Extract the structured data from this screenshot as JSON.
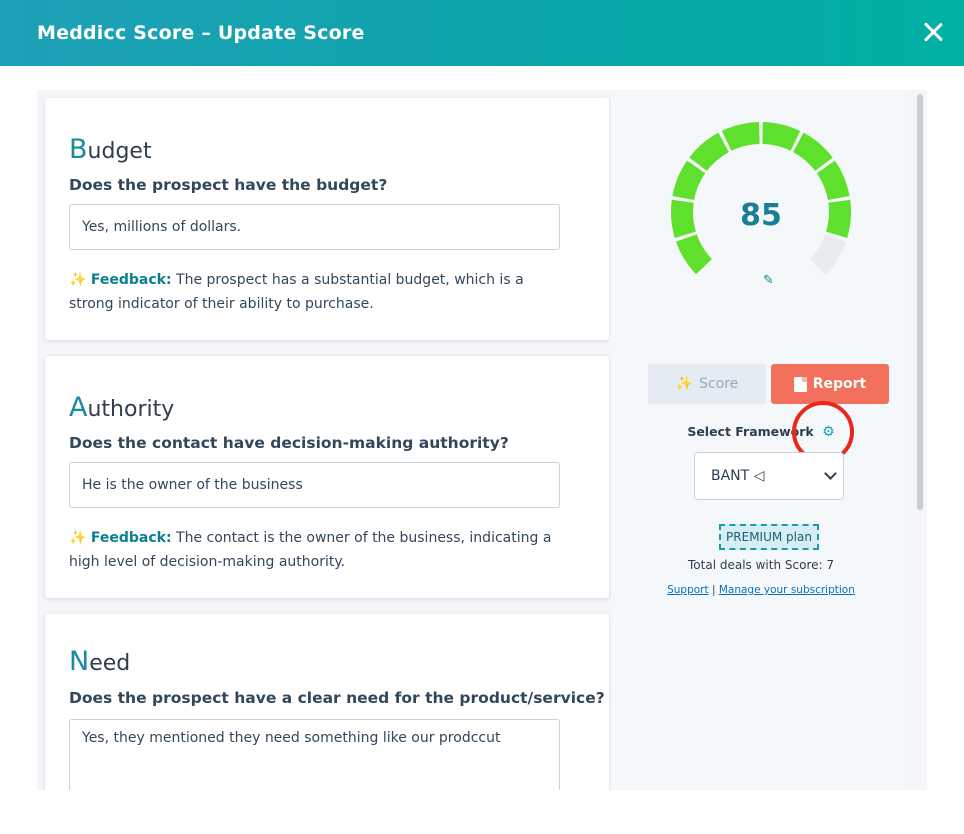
{
  "header": {
    "title": "Meddicc Score – Update Score"
  },
  "cards": [
    {
      "title_initial": "B",
      "title_rest": "udget",
      "question": "Does the prospect have the budget?",
      "answer": "Yes, millions of dollars.",
      "feedback_label": "Feedback:",
      "feedback_text": "The prospect has a substantial budget, which is a strong indicator of their ability to purchase."
    },
    {
      "title_initial": "A",
      "title_rest": "uthority",
      "question": "Does the contact have decision-making authority?",
      "answer": "He is the owner of the business",
      "feedback_label": "Feedback:",
      "feedback_text": "The contact is the owner of the business, indicating a high level of decision-making authority."
    },
    {
      "title_initial": "N",
      "title_rest": "eed",
      "question": "Does the prospect have a clear need for the product/service?",
      "answer": "Yes, they mentioned they need something like our prodccut"
    }
  ],
  "score_panel": {
    "score": "85",
    "score_value": 85,
    "score_max": 100,
    "gauge_segments": 10,
    "gauge_filled_color": "#5ee02c",
    "gauge_empty_color": "#e9ebee",
    "score_button": "Score",
    "report_button": "Report",
    "framework_label": "Select Framework",
    "framework_selected": "BANT ◁",
    "plan_badge": "PREMIUM plan",
    "deals_text": "Total deals with Score: 7",
    "support_link": "Support",
    "separator": "|",
    "subscription_link": "Manage your subscription",
    "highlight_color": "#e8281c"
  }
}
